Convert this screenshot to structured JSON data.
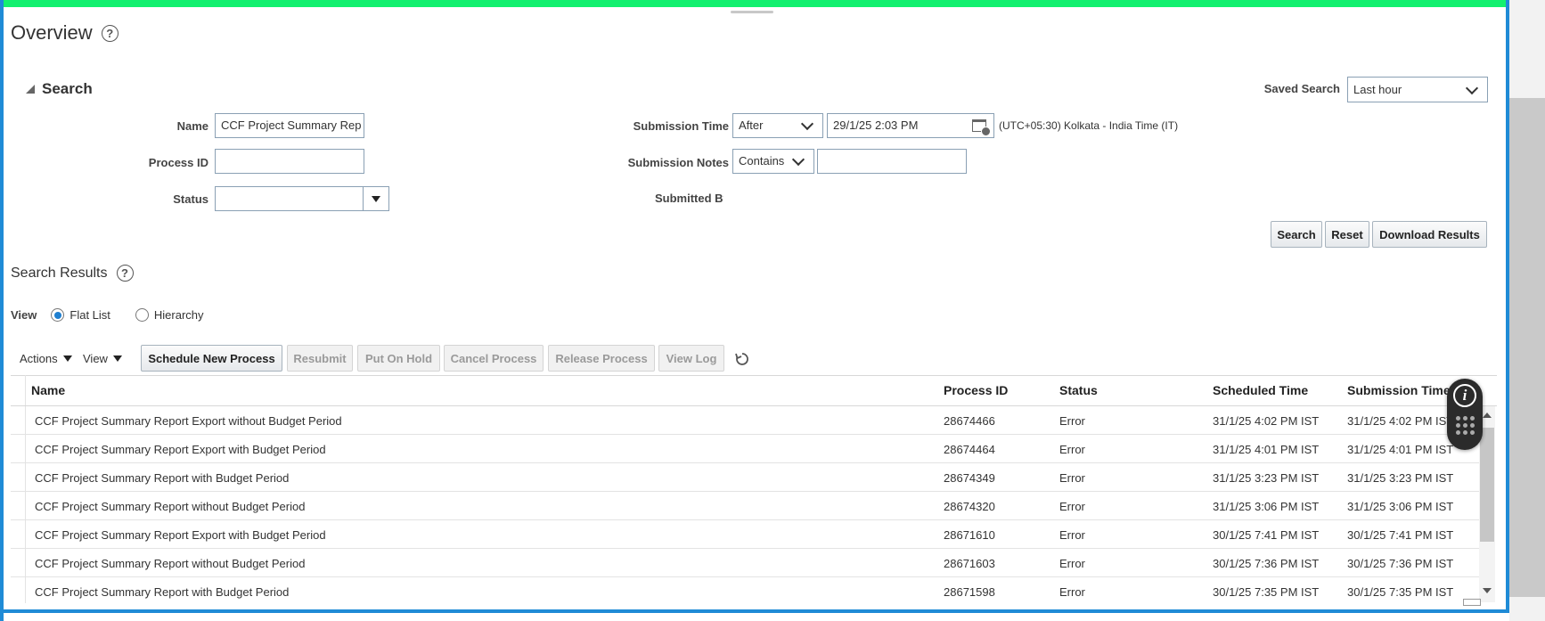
{
  "page": {
    "title": "Overview",
    "help_icon": "?"
  },
  "search": {
    "section_title": "Search",
    "saved_search_label": "Saved Search",
    "saved_search_value": "Last hour",
    "name_label": "Name",
    "name_value": "CCF Project Summary Rep",
    "process_id_label": "Process ID",
    "process_id_value": "",
    "status_label": "Status",
    "status_value": "",
    "submission_time_label": "Submission Time",
    "submission_time_operator": "After",
    "submission_time_value": "29/1/25 2:03 PM",
    "timezone": "(UTC+05:30) Kolkata - India Time (IT)",
    "submission_notes_label": "Submission Notes",
    "submission_notes_operator": "Contains",
    "submission_notes_value": "",
    "submitted_by_label": "Submitted By",
    "search_button": "Search",
    "reset_button": "Reset",
    "download_button": "Download Results"
  },
  "results": {
    "title": "Search Results",
    "view_label": "View",
    "view_options": [
      "Flat List",
      "Hierarchy"
    ],
    "selected_view": "Flat List",
    "toolbar": {
      "actions": "Actions",
      "view": "View",
      "schedule": "Schedule New Process",
      "resubmit": "Resubmit",
      "put_on_hold": "Put On Hold",
      "cancel": "Cancel Process",
      "release": "Release Process",
      "view_log": "View Log"
    },
    "columns": [
      "Name",
      "Process ID",
      "Status",
      "Scheduled Time",
      "Submission Time"
    ],
    "rows": [
      {
        "name": "CCF Project Summary Report Export without Budget Period",
        "process_id": "28674466",
        "status": "Error",
        "scheduled": "31/1/25 4:02 PM IST",
        "submitted": "31/1/25 4:02 PM IST"
      },
      {
        "name": "CCF Project Summary Report Export with Budget Period",
        "process_id": "28674464",
        "status": "Error",
        "scheduled": "31/1/25 4:01 PM IST",
        "submitted": "31/1/25 4:01 PM IST"
      },
      {
        "name": "CCF Project Summary Report with Budget Period",
        "process_id": "28674349",
        "status": "Error",
        "scheduled": "31/1/25 3:23 PM IST",
        "submitted": "31/1/25 3:23 PM IST"
      },
      {
        "name": "CCF Project Summary Report without Budget Period",
        "process_id": "28674320",
        "status": "Error",
        "scheduled": "31/1/25 3:06 PM IST",
        "submitted": "31/1/25 3:06 PM IST"
      },
      {
        "name": "CCF Project Summary Report Export with Budget Period",
        "process_id": "28671610",
        "status": "Error",
        "scheduled": "30/1/25 7:41 PM IST",
        "submitted": "30/1/25 7:41 PM IST"
      },
      {
        "name": "CCF Project Summary Report without Budget Period",
        "process_id": "28671603",
        "status": "Error",
        "scheduled": "30/1/25 7:36 PM IST",
        "submitted": "30/1/25 7:36 PM IST"
      },
      {
        "name": "CCF Project Summary Report with Budget Period",
        "process_id": "28671598",
        "status": "Error",
        "scheduled": "30/1/25 7:35 PM IST",
        "submitted": "30/1/25 7:35 PM IST"
      }
    ]
  },
  "floating": {
    "info_glyph": "i"
  },
  "colors": {
    "top_bar": "#12f06f",
    "frame": "#1f8bd6",
    "radio_selected": "#1f7fd0"
  }
}
